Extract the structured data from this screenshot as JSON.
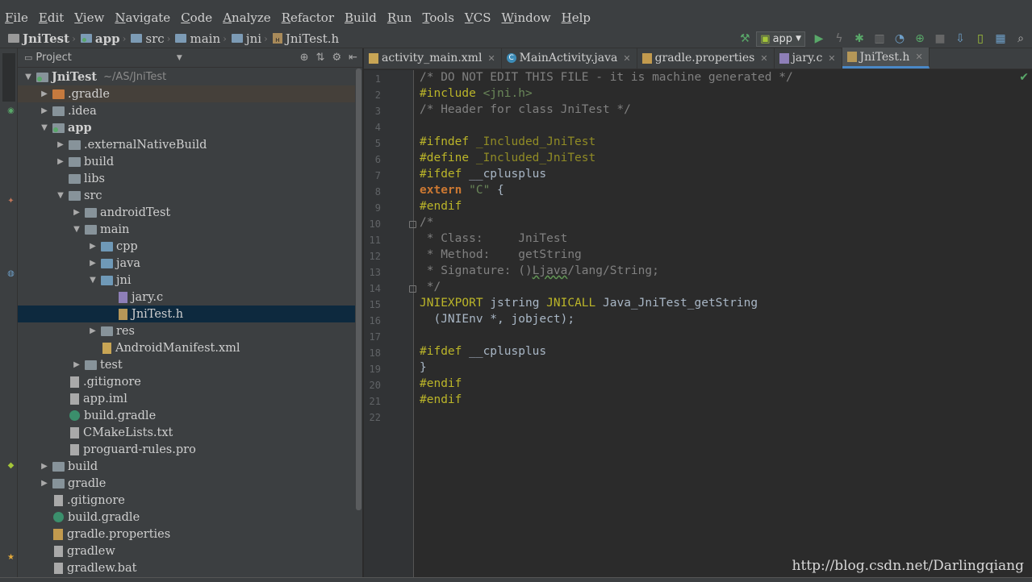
{
  "menu": [
    "File",
    "Edit",
    "View",
    "Navigate",
    "Code",
    "Analyze",
    "Refactor",
    "Build",
    "Run",
    "Tools",
    "VCS",
    "Window",
    "Help"
  ],
  "breadcrumb": [
    "JniTest",
    "app",
    "src",
    "main",
    "jni",
    "JniTest.h"
  ],
  "toolbar": {
    "run_config": "app",
    "icons": [
      "make-icon",
      "run-icon",
      "apply-changes-icon",
      "debug-icon",
      "coverage-icon",
      "profile-icon",
      "attach-debugger-icon",
      "stop-icon",
      "sdk-manager-icon",
      "avd-manager-icon",
      "project-structure-icon",
      "search-icon"
    ]
  },
  "project_panel": {
    "title": "Project",
    "tree": [
      {
        "depth": 0,
        "arrow": "▼",
        "icon": "module",
        "label": "JniTest",
        "hint": "~/AS/JniTest"
      },
      {
        "depth": 1,
        "arrow": "▶",
        "icon": "folder-orange",
        "label": ".gradle",
        "highlight": true
      },
      {
        "depth": 1,
        "arrow": "▶",
        "icon": "folder",
        "label": ".idea"
      },
      {
        "depth": 1,
        "arrow": "▼",
        "icon": "module",
        "label": "app",
        "bold": true
      },
      {
        "depth": 2,
        "arrow": "▶",
        "icon": "folder",
        "label": ".externalNativeBuild"
      },
      {
        "depth": 2,
        "arrow": "▶",
        "icon": "folder",
        "label": "build"
      },
      {
        "depth": 2,
        "arrow": "",
        "icon": "folder",
        "label": "libs"
      },
      {
        "depth": 2,
        "arrow": "▼",
        "icon": "folder",
        "label": "src"
      },
      {
        "depth": 3,
        "arrow": "▶",
        "icon": "folder",
        "label": "androidTest"
      },
      {
        "depth": 3,
        "arrow": "▼",
        "icon": "folder",
        "label": "main"
      },
      {
        "depth": 4,
        "arrow": "▶",
        "icon": "folder-blue",
        "label": "cpp"
      },
      {
        "depth": 4,
        "arrow": "▶",
        "icon": "folder-blue",
        "label": "java"
      },
      {
        "depth": 4,
        "arrow": "▼",
        "icon": "folder-blue",
        "label": "jni"
      },
      {
        "depth": 5,
        "arrow": "",
        "icon": "file-c",
        "label": "jary.c"
      },
      {
        "depth": 5,
        "arrow": "",
        "icon": "file-h",
        "label": "JniTest.h",
        "selected": true
      },
      {
        "depth": 4,
        "arrow": "▶",
        "icon": "folder",
        "label": "res"
      },
      {
        "depth": 4,
        "arrow": "",
        "icon": "file-xml",
        "label": "AndroidManifest.xml"
      },
      {
        "depth": 3,
        "arrow": "▶",
        "icon": "folder",
        "label": "test"
      },
      {
        "depth": 2,
        "arrow": "",
        "icon": "file",
        "label": ".gitignore"
      },
      {
        "depth": 2,
        "arrow": "",
        "icon": "file",
        "label": "app.iml"
      },
      {
        "depth": 2,
        "arrow": "",
        "icon": "gradle",
        "label": "build.gradle"
      },
      {
        "depth": 2,
        "arrow": "",
        "icon": "file",
        "label": "CMakeLists.txt"
      },
      {
        "depth": 2,
        "arrow": "",
        "icon": "file",
        "label": "proguard-rules.pro"
      },
      {
        "depth": 1,
        "arrow": "▶",
        "icon": "folder",
        "label": "build"
      },
      {
        "depth": 1,
        "arrow": "▶",
        "icon": "folder",
        "label": "gradle"
      },
      {
        "depth": 1,
        "arrow": "",
        "icon": "file",
        "label": ".gitignore"
      },
      {
        "depth": 1,
        "arrow": "",
        "icon": "gradle",
        "label": "build.gradle"
      },
      {
        "depth": 1,
        "arrow": "",
        "icon": "props",
        "label": "gradle.properties"
      },
      {
        "depth": 1,
        "arrow": "",
        "icon": "file",
        "label": "gradlew"
      },
      {
        "depth": 1,
        "arrow": "",
        "icon": "file",
        "label": "gradlew.bat"
      }
    ]
  },
  "tabs": [
    {
      "label": "activity_main.xml",
      "icon": "xml"
    },
    {
      "label": "MainActivity.java",
      "icon": "java"
    },
    {
      "label": "gradle.properties",
      "icon": "props"
    },
    {
      "label": "jary.c",
      "icon": "c"
    },
    {
      "label": "JniTest.h",
      "icon": "h",
      "active": true
    }
  ],
  "code_lines": [
    [
      [
        "c-comment",
        "/* DO NOT EDIT THIS FILE - it is machine generated */"
      ]
    ],
    [
      [
        "c-pre",
        "#include "
      ],
      [
        "c-str",
        "<jni.h>"
      ]
    ],
    [
      [
        "c-comment",
        "/* Header for class JniTest */"
      ]
    ],
    [],
    [
      [
        "c-pre",
        "#ifndef "
      ],
      [
        "c-macro",
        "_Included_JniTest"
      ]
    ],
    [
      [
        "c-pre",
        "#define "
      ],
      [
        "c-macro",
        "_Included_JniTest"
      ]
    ],
    [
      [
        "c-pre",
        "#ifdef "
      ],
      [
        "c-type",
        "__cplusplus"
      ]
    ],
    [
      [
        "c-kw",
        "extern "
      ],
      [
        "c-str",
        "\"C\""
      ],
      [
        "c-type",
        " {"
      ]
    ],
    [
      [
        "c-pre",
        "#endif"
      ]
    ],
    [
      [
        "c-comment",
        "/*"
      ]
    ],
    [
      [
        "c-comment",
        " * Class:     JniTest"
      ]
    ],
    [
      [
        "c-comment",
        " * Method:    getString"
      ]
    ],
    [
      [
        "c-comment",
        " * Signature: ()"
      ],
      [
        "c-comment c-ul",
        "Ljava"
      ],
      [
        "c-comment",
        "/lang/String;"
      ]
    ],
    [
      [
        "c-comment",
        " */"
      ]
    ],
    [
      [
        "c-pre",
        "JNIEXPORT "
      ],
      [
        "c-type",
        "jstring "
      ],
      [
        "c-pre",
        "JNICALL "
      ],
      [
        "c-type",
        "Java_JniTest_getString"
      ]
    ],
    [
      [
        "c-type",
        "  (JNIEnv *, jobject);"
      ]
    ],
    [],
    [
      [
        "c-pre",
        "#ifdef "
      ],
      [
        "c-type",
        "__cplusplus"
      ]
    ],
    [
      [
        "c-type",
        "}"
      ]
    ],
    [
      [
        "c-pre",
        "#endif"
      ]
    ],
    [
      [
        "c-pre",
        "#endif"
      ]
    ],
    []
  ],
  "watermark": "http://blog.csdn.net/Darlingqiang"
}
